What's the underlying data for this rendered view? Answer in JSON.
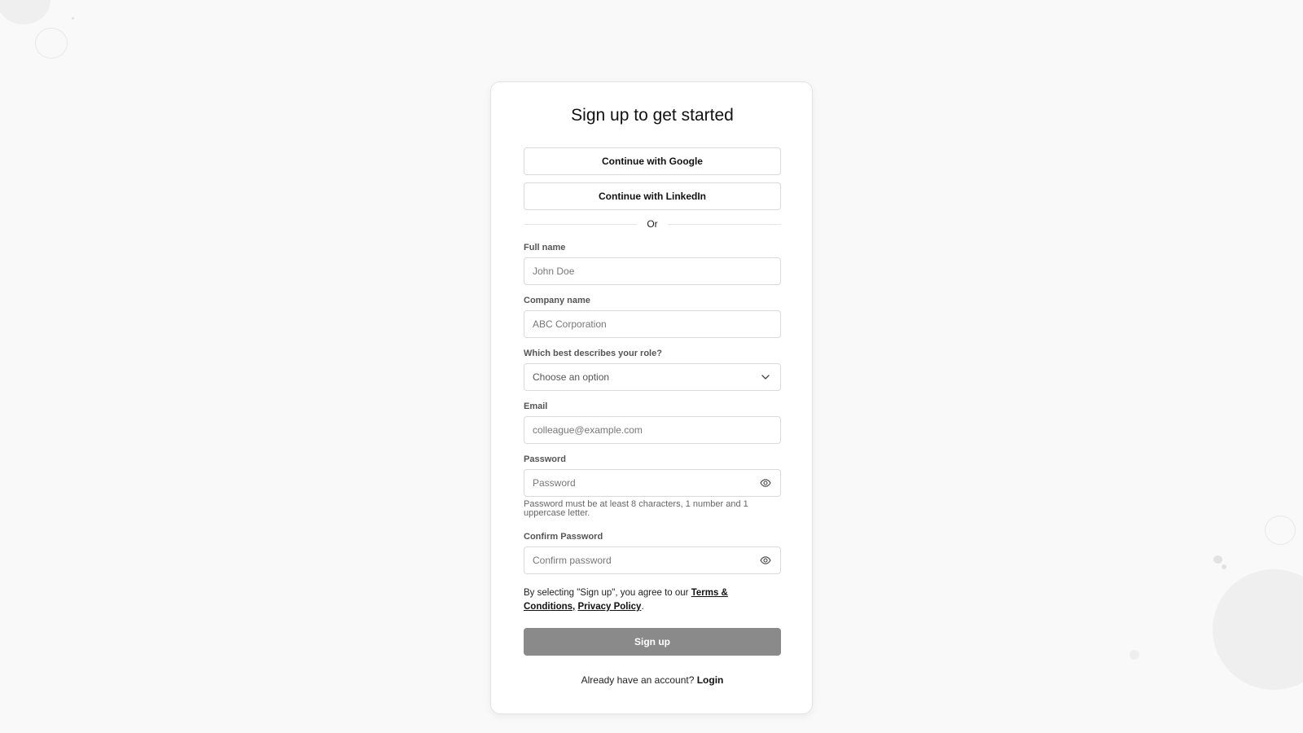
{
  "page": {
    "title": "Sign up to get started"
  },
  "social": {
    "google_label": "Continue with Google",
    "linkedin_label": "Continue with LinkedIn"
  },
  "divider": {
    "text": "Or"
  },
  "form": {
    "full_name": {
      "label": "Full name",
      "placeholder": "John Doe",
      "value": ""
    },
    "company_name": {
      "label": "Company name",
      "placeholder": "ABC Corporation",
      "value": ""
    },
    "role": {
      "label": "Which best describes your role?",
      "selected": "Choose an option"
    },
    "email": {
      "label": "Email",
      "placeholder": "colleague@example.com",
      "value": ""
    },
    "password": {
      "label": "Password",
      "placeholder": "Password",
      "value": "",
      "hint": "Password must be at least 8 characters, 1 number and 1 uppercase letter."
    },
    "confirm_password": {
      "label": "Confirm Password",
      "placeholder": "Confirm password",
      "value": ""
    }
  },
  "terms": {
    "prefix": "By selecting \"Sign up\", you agree to our ",
    "terms_link": "Terms & Conditions,",
    "privacy_link": "Privacy Policy",
    "suffix": "."
  },
  "submit": {
    "label": "Sign up"
  },
  "footer": {
    "text": "Already have an account? ",
    "login_link": "Login"
  },
  "icons": {
    "role_dropdown": "chevron-down-icon",
    "password_toggle": "eye-icon",
    "confirm_password_toggle": "eye-icon"
  },
  "colors": {
    "background": "#f9f9f9",
    "card": "#ffffff",
    "primary_button": "#8a8a8a",
    "border": "#d9d9d9"
  }
}
